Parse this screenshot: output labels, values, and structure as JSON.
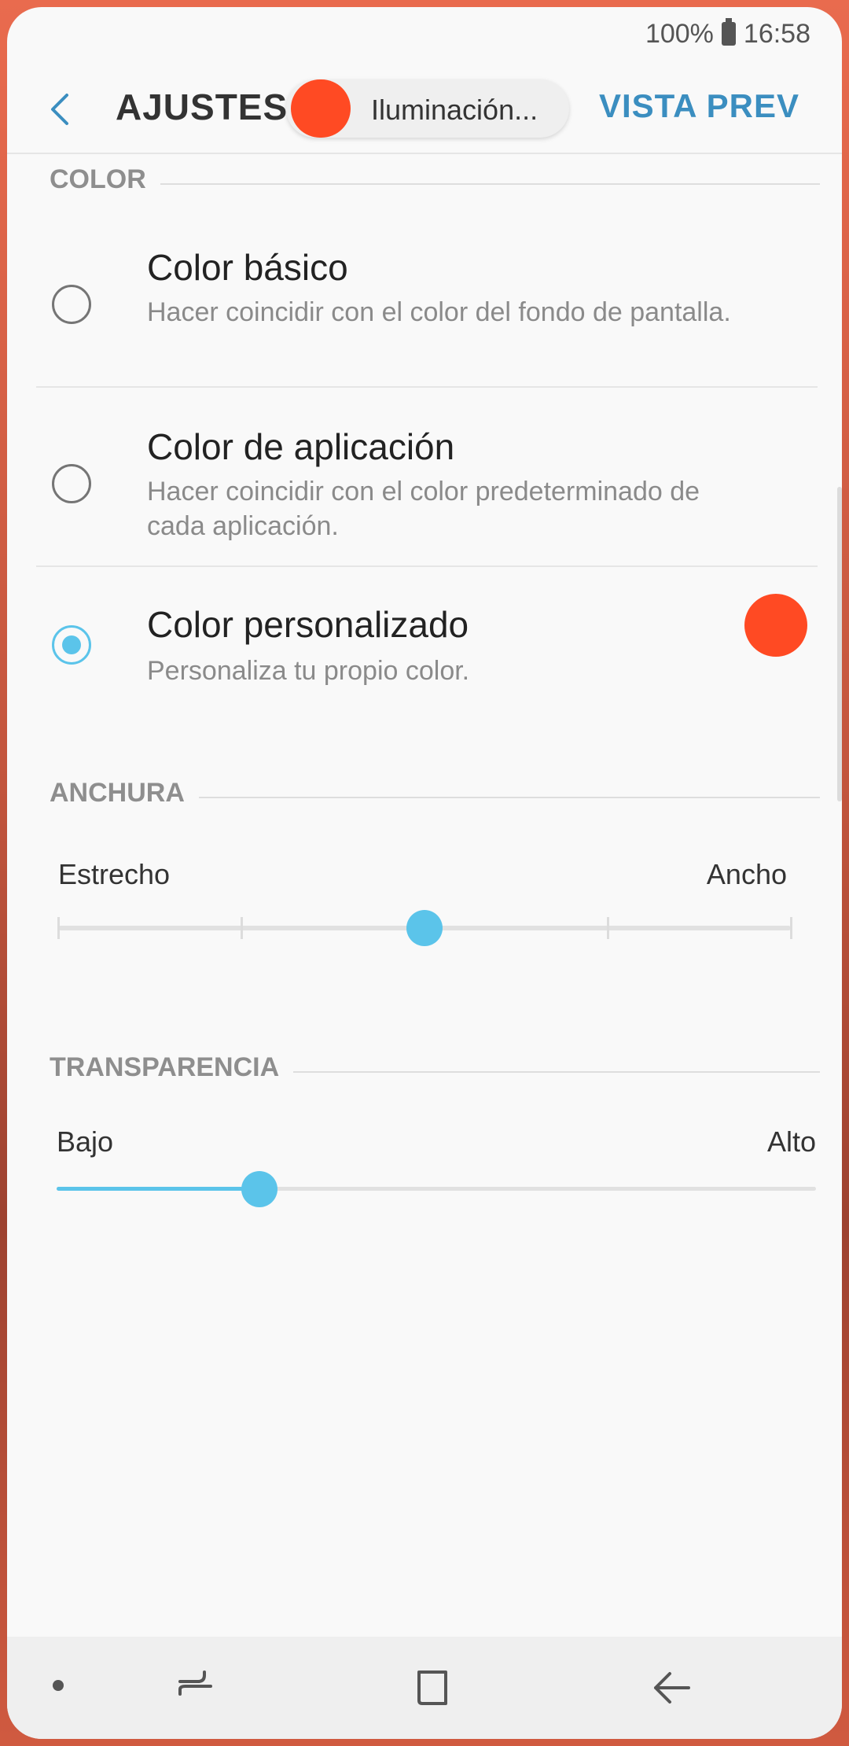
{
  "status_bar": {
    "battery": "100%",
    "time": "16:58"
  },
  "header": {
    "title": "AJUSTES A",
    "action": "VISTA PREV",
    "notification_pill_text": "Iluminación..."
  },
  "sections": {
    "color": "COLOR",
    "width": "ANCHURA",
    "transparency": "TRANSPARENCIA"
  },
  "color_options": [
    {
      "title": "Color básico",
      "description": "Hacer coincidir con el color del fondo de pantalla.",
      "selected": false
    },
    {
      "title": "Color de aplicación",
      "description": "Hacer coincidir con el color predeterminado de cada aplicación.",
      "selected": false
    },
    {
      "title": "Color personalizado",
      "description": "Personaliza tu propio color.",
      "selected": true
    }
  ],
  "custom_color": "#FF4A23",
  "accent_color": "#5BC4EA",
  "width_slider": {
    "min_label": "Estrecho",
    "max_label": "Ancho",
    "steps": 5,
    "value_step": 3
  },
  "transparency_slider": {
    "min_label": "Bajo",
    "max_label": "Alto",
    "value_fraction": 0.27
  },
  "navbar": {
    "icons": [
      "dot-icon",
      "recents-icon",
      "home-icon",
      "back-icon"
    ]
  }
}
